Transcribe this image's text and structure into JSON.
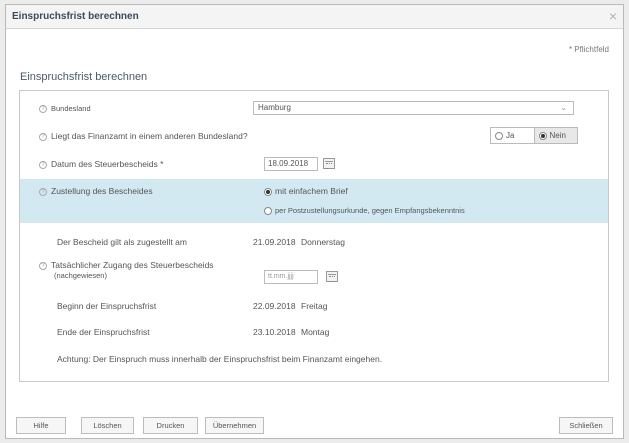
{
  "window": {
    "title": "Einspruchsfrist berechnen",
    "close": "×"
  },
  "required_note": "* Pflichtfeld",
  "section_title": "Einspruchsfrist berechnen",
  "form": {
    "bundesland": {
      "label": "Bundesland",
      "value": "Hamburg"
    },
    "anderes_bundesland": {
      "label": "Liegt das Finanzamt in einem anderen Bundesland?",
      "options": [
        "Ja",
        "Nein"
      ],
      "selected": "Nein"
    },
    "datum_steuerbescheid": {
      "label": "Datum des Steuerbescheids *",
      "value": "18.09.2018"
    },
    "zustellung": {
      "label": "Zustellung des Bescheides",
      "options": [
        "mit einfachem Brief",
        "per Postzustellungsurkunde, gegen Empfangsbekenntnis"
      ],
      "selected": "mit einfachem Brief"
    },
    "zugestellt": {
      "label": "Der Bescheid gilt als zugestellt am",
      "date": "21.09.2018",
      "weekday": "Donnerstag"
    },
    "tatsaechlicher_zugang": {
      "label_line1": "Tatsächlicher Zugang des Steuerbescheids",
      "label_line2": "(nachgewiesen)",
      "placeholder": "tt.mm.jjjj"
    },
    "beginn": {
      "label": "Beginn der Einspruchsfrist",
      "date": "22.09.2018",
      "weekday": "Freitag"
    },
    "ende": {
      "label": "Ende der Einspruchsfrist",
      "date": "23.10.2018",
      "weekday": "Montag"
    },
    "hinweis": "Achtung: Der Einspruch muss innerhalb der Einspruchsfrist beim Finanzamt eingehen."
  },
  "footer": {
    "buttons": [
      "Hilfe",
      "Löschen",
      "Drucken",
      "Übernehmen"
    ],
    "close_button": "Schließen"
  },
  "icons": {
    "help": "?",
    "chevron": "⌄"
  }
}
